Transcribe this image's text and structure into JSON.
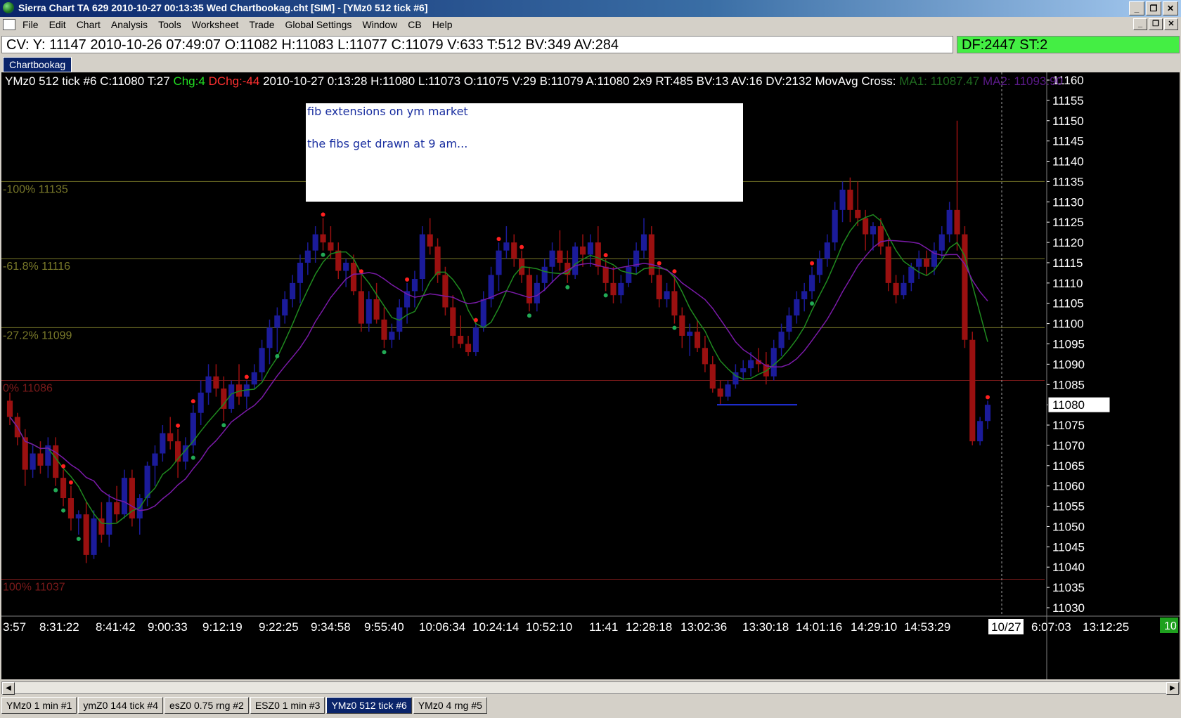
{
  "window": {
    "title": "Sierra Chart TA 629  2010-10-27  00:13:35  Wed   Chartbookag.cht [SIM] - [YMz0  512 tick  #6]",
    "controls": [
      "_",
      "❐",
      "✕"
    ]
  },
  "menu": {
    "items": [
      "File",
      "Edit",
      "Chart",
      "Analysis",
      "Tools",
      "Worksheet",
      "Trade",
      "Global Settings",
      "Window",
      "CB",
      "Help"
    ]
  },
  "infobar": {
    "text": "CV: Y: 11147  2010-10-26  07:49:07  O:11082  H:11083  L:11077  C:11079  V:633  T:512  BV:349  AV:284"
  },
  "status": {
    "text": "DF:2447  ST:2",
    "color": "#44ee44"
  },
  "chartbook_tab": "Chartbookag",
  "chart_header": {
    "symbol": "YMz0  512 tick  #6",
    "close": "C:11080",
    "ticks": "T:27",
    "chg": "Chg:4",
    "dchg": "DChg:-44",
    "details": "2010-10-27 0:13:28 H:11080 L:11073 O:11075 V:29 B:11079 A:11080 2x9 RT:485 BV:13 AV:16 DV:2132 MovAvg Cross:",
    "ma1": "MA1: 11087.47",
    "ma2": "MA2: 11093.90"
  },
  "note": {
    "line1": "fib extensions on ym market",
    "line2": "the fibs get drawn at 9 am..."
  },
  "chart_data": {
    "type": "candlestick",
    "price_labels": [
      "11160",
      "11155",
      "11150",
      "11145",
      "11140",
      "11135",
      "11130",
      "11125",
      "11120",
      "11115",
      "11110",
      "11105",
      "11100",
      "11095",
      "11090",
      "11085",
      "11080",
      "11075",
      "11070",
      "11065",
      "11060",
      "11055",
      "11050",
      "11045",
      "11040",
      "11035",
      "11030"
    ],
    "y_range": [
      11030,
      11160
    ],
    "current_price": "11080",
    "time_labels": [
      "3:57",
      "8:31:22",
      "8:41:42",
      "9:00:33",
      "9:12:19",
      "9:22:25",
      "9:34:58",
      "9:55:40",
      "10:06:34",
      "10:24:14",
      "10:52:10",
      "11:41",
      "12:28:18",
      "13:02:36",
      "13:30:18",
      "14:01:16",
      "14:29:10",
      "14:53:29",
      "10/27",
      "6:07:03",
      "13:12:25"
    ],
    "fib_levels": [
      {
        "label": "-100% 11135",
        "price": 11135,
        "color": "#7a7a2a"
      },
      {
        "label": "-61.8% 11116",
        "price": 11116,
        "color": "#7a7a2a"
      },
      {
        "label": "-27.2% 11099",
        "price": 11099,
        "color": "#7a7a2a"
      },
      {
        "label": "0% 11086",
        "price": 11086,
        "color": "#7a1a1a"
      },
      {
        "label": "100% 11037",
        "price": 11037,
        "color": "#7a1a1a"
      }
    ],
    "series": [
      {
        "name": "MA1",
        "color": "#1f8a1f"
      },
      {
        "name": "MA2",
        "color": "#7a1aa8"
      }
    ],
    "candles": [
      [
        11081,
        11083,
        11075,
        11077
      ],
      [
        11077,
        11078,
        11070,
        11072
      ],
      [
        11072,
        11074,
        11060,
        11064
      ],
      [
        11064,
        11070,
        11062,
        11068
      ],
      [
        11068,
        11071,
        11063,
        11065
      ],
      [
        11065,
        11072,
        11062,
        11070
      ],
      [
        11070,
        11072,
        11060,
        11062
      ],
      [
        11062,
        11064,
        11055,
        11057
      ],
      [
        11057,
        11060,
        11049,
        11052
      ],
      [
        11052,
        11054,
        11048,
        11053
      ],
      [
        11053,
        11056,
        11041,
        11043
      ],
      [
        11043,
        11054,
        11042,
        11052
      ],
      [
        11052,
        11056,
        11046,
        11048
      ],
      [
        11048,
        11058,
        11045,
        11056
      ],
      [
        11056,
        11060,
        11051,
        11053
      ],
      [
        11053,
        11064,
        11052,
        11062
      ],
      [
        11062,
        11064,
        11050,
        11052
      ],
      [
        11052,
        11058,
        11048,
        11057
      ],
      [
        11057,
        11066,
        11055,
        11065
      ],
      [
        11065,
        11070,
        11060,
        11068
      ],
      [
        11068,
        11075,
        11066,
        11073
      ],
      [
        11073,
        11077,
        11069,
        11071
      ],
      [
        11071,
        11074,
        11062,
        11066
      ],
      [
        11066,
        11072,
        11064,
        11070
      ],
      [
        11070,
        11080,
        11068,
        11078
      ],
      [
        11078,
        11086,
        11075,
        11083
      ],
      [
        11083,
        11090,
        11080,
        11087
      ],
      [
        11087,
        11090,
        11082,
        11084
      ],
      [
        11084,
        11087,
        11076,
        11079
      ],
      [
        11079,
        11086,
        11078,
        11085
      ],
      [
        11085,
        11090,
        11080,
        11082
      ],
      [
        11082,
        11086,
        11079,
        11085
      ],
      [
        11085,
        11090,
        11084,
        11088
      ],
      [
        11088,
        11096,
        11086,
        11094
      ],
      [
        11094,
        11101,
        11090,
        11099
      ],
      [
        11099,
        11104,
        11093,
        11102
      ],
      [
        11102,
        11108,
        11100,
        11106
      ],
      [
        11106,
        11112,
        11104,
        11110
      ],
      [
        11110,
        11117,
        11105,
        11115
      ],
      [
        11115,
        11120,
        11112,
        11118
      ],
      [
        11118,
        11124,
        11115,
        11122
      ],
      [
        11122,
        11126,
        11118,
        11120
      ],
      [
        11120,
        11124,
        11116,
        11118
      ],
      [
        11118,
        11120,
        11111,
        11113
      ],
      [
        11113,
        11116,
        11109,
        11115
      ],
      [
        11115,
        11117,
        11107,
        11108
      ],
      [
        11108,
        11112,
        11098,
        11100
      ],
      [
        11100,
        11108,
        11098,
        11106
      ],
      [
        11106,
        11110,
        11100,
        11101
      ],
      [
        11101,
        11104,
        11094,
        11096
      ],
      [
        11096,
        11100,
        11094,
        11098
      ],
      [
        11098,
        11106,
        11096,
        11104
      ],
      [
        11104,
        11110,
        11100,
        11108
      ],
      [
        11108,
        11113,
        11104,
        11111
      ],
      [
        11111,
        11124,
        11108,
        11122
      ],
      [
        11122,
        11126,
        11117,
        11119
      ],
      [
        11119,
        11121,
        11110,
        11112
      ],
      [
        11112,
        11114,
        11102,
        11104
      ],
      [
        11104,
        11107,
        11094,
        11097
      ],
      [
        11097,
        11102,
        11094,
        11095
      ],
      [
        11095,
        11097,
        11092,
        11093
      ],
      [
        11093,
        11100,
        11092,
        11099
      ],
      [
        11099,
        11108,
        11098,
        11106
      ],
      [
        11106,
        11114,
        11104,
        11112
      ],
      [
        11112,
        11120,
        11108,
        11118
      ],
      [
        11118,
        11124,
        11116,
        11120
      ],
      [
        11120,
        11122,
        11114,
        11116
      ],
      [
        11116,
        11118,
        11110,
        11112
      ],
      [
        11112,
        11114,
        11103,
        11105
      ],
      [
        11105,
        11112,
        11103,
        11110
      ],
      [
        11110,
        11116,
        11108,
        11114
      ],
      [
        11114,
        11120,
        11110,
        11118
      ],
      [
        11118,
        11123,
        11113,
        11115
      ],
      [
        11115,
        11118,
        11110,
        11112
      ],
      [
        11112,
        11120,
        11111,
        11119
      ],
      [
        11119,
        11122,
        11114,
        11117
      ],
      [
        11117,
        11122,
        11114,
        11120
      ],
      [
        11120,
        11124,
        11112,
        11114
      ],
      [
        11114,
        11116,
        11108,
        11110
      ],
      [
        11110,
        11114,
        11105,
        11107
      ],
      [
        11107,
        11112,
        11105,
        11110
      ],
      [
        11110,
        11116,
        11109,
        11114
      ],
      [
        11114,
        11120,
        11112,
        11118
      ],
      [
        11118,
        11126,
        11116,
        11122
      ],
      [
        11122,
        11124,
        11110,
        11112
      ],
      [
        11112,
        11114,
        11104,
        11106
      ],
      [
        11106,
        11110,
        11104,
        11108
      ],
      [
        11108,
        11112,
        11100,
        11102
      ],
      [
        11102,
        11104,
        11094,
        11097
      ],
      [
        11097,
        11100,
        11092,
        11098
      ],
      [
        11098,
        11101,
        11093,
        11094
      ],
      [
        11094,
        11097,
        11088,
        11090
      ],
      [
        11090,
        11092,
        11083,
        11084
      ],
      [
        11084,
        11086,
        11080,
        11082
      ],
      [
        11082,
        11086,
        11081,
        11085
      ],
      [
        11085,
        11090,
        11084,
        11088
      ],
      [
        11088,
        11091,
        11086,
        11089
      ],
      [
        11089,
        11093,
        11087,
        11091
      ],
      [
        11091,
        11094,
        11088,
        11090
      ],
      [
        11090,
        11093,
        11085,
        11087
      ],
      [
        11087,
        11096,
        11086,
        11094
      ],
      [
        11094,
        11100,
        11092,
        11098
      ],
      [
        11098,
        11104,
        11096,
        11102
      ],
      [
        11102,
        11108,
        11100,
        11106
      ],
      [
        11106,
        11110,
        11103,
        11108
      ],
      [
        11108,
        11114,
        11106,
        11112
      ],
      [
        11112,
        11118,
        11110,
        11116
      ],
      [
        11116,
        11122,
        11114,
        11120
      ],
      [
        11120,
        11130,
        11118,
        11128
      ],
      [
        11128,
        11135,
        11125,
        11133
      ],
      [
        11133,
        11136,
        11125,
        11128
      ],
      [
        11128,
        11135,
        11124,
        11126
      ],
      [
        11126,
        11128,
        11118,
        11122
      ],
      [
        11122,
        11125,
        11118,
        11124
      ],
      [
        11124,
        11126,
        11117,
        11119
      ],
      [
        11119,
        11121,
        11108,
        11110
      ],
      [
        11110,
        11112,
        11105,
        11107
      ],
      [
        11107,
        11112,
        11106,
        11110
      ],
      [
        11110,
        11115,
        11108,
        11114
      ],
      [
        11114,
        11118,
        11111,
        11116
      ],
      [
        11116,
        11118,
        11112,
        11114
      ],
      [
        11114,
        11120,
        11112,
        11118
      ],
      [
        11118,
        11124,
        11116,
        11122
      ],
      [
        11122,
        11130,
        11120,
        11128
      ],
      [
        11128,
        11150,
        11118,
        11122
      ],
      [
        11122,
        11124,
        11094,
        11096
      ],
      [
        11096,
        11098,
        11070,
        11071
      ],
      [
        11071,
        11077,
        11070,
        11076
      ],
      [
        11076,
        11081,
        11074,
        11080
      ]
    ],
    "red_dots": [
      15,
      18,
      48,
      53,
      68,
      91,
      102,
      115,
      135,
      141,
      148,
      174,
      188,
      194,
      232,
      284
    ],
    "green_dots": [
      13,
      16,
      20,
      53,
      63,
      77,
      91,
      108,
      150,
      162,
      174,
      194,
      234
    ]
  }
}
